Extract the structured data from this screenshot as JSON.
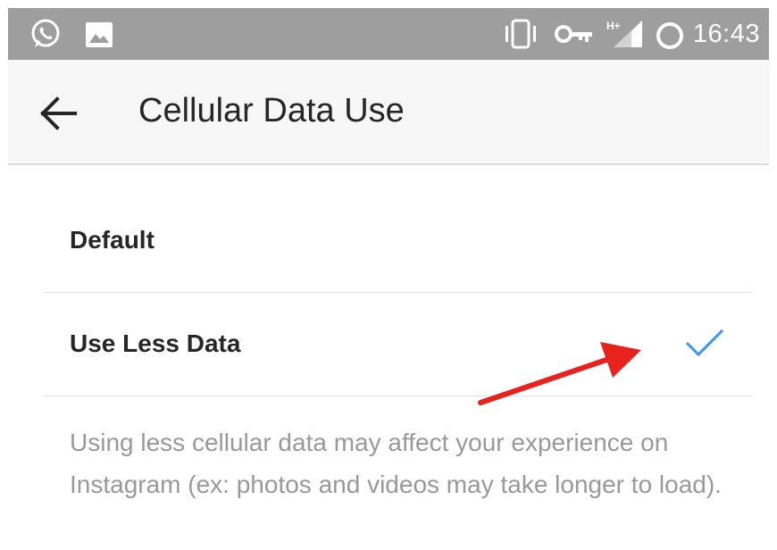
{
  "status_bar": {
    "time": "16:43",
    "left_icons": [
      "whatsapp-icon",
      "image-icon"
    ],
    "right_icons": [
      "vibrate-icon",
      "vpn-key-icon",
      "signal-hplus-icon",
      "sync-icon"
    ],
    "network_label": "H+"
  },
  "app_bar": {
    "back_icon": "arrow-left-icon",
    "title": "Cellular Data Use"
  },
  "options": [
    {
      "label": "Default",
      "selected": false
    },
    {
      "label": "Use Less Data",
      "selected": true
    }
  ],
  "description": "Using less cellular data may affect your experience on Instagram (ex: photos and videos may take longer to load).",
  "colors": {
    "status_bar": "#9e9e9e",
    "app_bar": "#f7f7f7",
    "check": "#3897f0",
    "annotation_arrow": "#e8221c",
    "title_text": "#262626",
    "description_text": "#999999"
  }
}
